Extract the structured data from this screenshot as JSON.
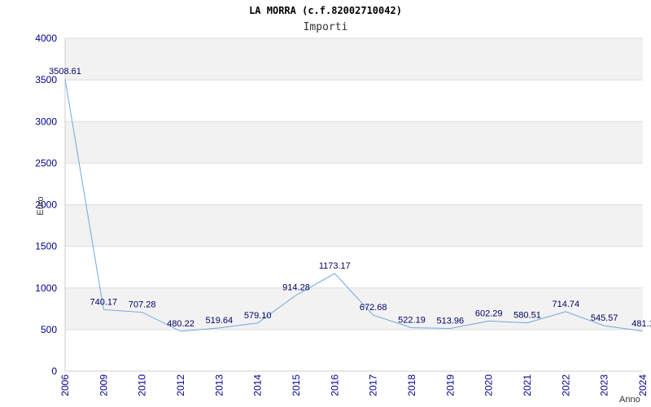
{
  "chart_data": {
    "type": "line",
    "title": "LA MORRA (c.f.82002710042)",
    "subtitle": "Importi",
    "ylabel": "Euro",
    "xlabel": "Anno",
    "ylim": [
      0,
      4000
    ],
    "yticks": [
      "0",
      "500",
      "1000",
      "1500",
      "2000",
      "2500",
      "3000",
      "3500",
      "4000"
    ],
    "grid": true,
    "categories": [
      "2006",
      "2009",
      "2010",
      "2012",
      "2013",
      "2014",
      "2015",
      "2016",
      "2017",
      "2018",
      "2019",
      "2020",
      "2021",
      "2022",
      "2023",
      "2024"
    ],
    "values": [
      3508.61,
      740.17,
      707.28,
      480.22,
      519.64,
      579.1,
      914.28,
      1173.17,
      672.68,
      522.19,
      513.96,
      602.29,
      580.51,
      714.74,
      545.57,
      481.1
    ],
    "data_labels": [
      "3508.61",
      "740.17",
      "707.28",
      "480.22",
      "519.64",
      "579.10",
      "914.28",
      "1173.17",
      "672.68",
      "522.19",
      "513.96",
      "602.29",
      "580.51",
      "714.74",
      "545.57",
      "481.1"
    ],
    "colors": {
      "line": "#6fa8dc",
      "band": "#f2f2f2",
      "tick_text": "#00008b",
      "label_text": "#000066"
    }
  }
}
